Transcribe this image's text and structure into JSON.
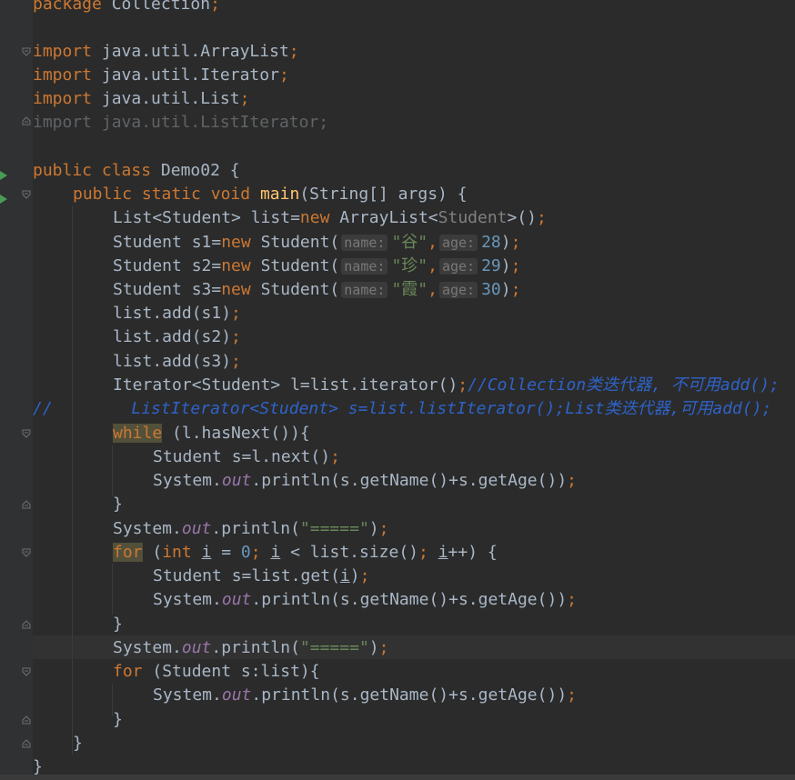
{
  "editor": {
    "lines": {
      "l1": {
        "package_kw": "package",
        "package_name": "Collection",
        "semi": ";"
      },
      "l3": {
        "kw": "import",
        "name": "java.util.ArrayList",
        "semi": ";"
      },
      "l4": {
        "kw": "import",
        "name": "java.util.Iterator",
        "semi": ";"
      },
      "l5": {
        "kw": "import",
        "name": "java.util.List",
        "semi": ";"
      },
      "l6": {
        "kw": "import",
        "name": "java.util.ListIterator",
        "semi": ";"
      },
      "l8": {
        "kw1": "public",
        "kw2": "class",
        "name": "Demo02",
        "brace": " {"
      },
      "l9": {
        "kw1": "public",
        "kw2": "static",
        "kw3": "void",
        "fn": "main",
        "rest": "(String[] args) {"
      },
      "l10": {
        "a": "List<Student> list=",
        "kw": "new",
        "b": " ArrayList<",
        "gen": "Student",
        "c": ">()",
        "semi": ";"
      },
      "l11": {
        "a": "Student s1=",
        "kw": "new",
        "b": " Student(",
        "hint1": "name:",
        "str": "\"谷\"",
        "comma": ",",
        "hint2": "age:",
        "num": "28",
        "c": ")",
        "semi": ";"
      },
      "l12": {
        "a": "Student s2=",
        "kw": "new",
        "b": " Student(",
        "hint1": "name:",
        "str": "\"珍\"",
        "comma": ",",
        "hint2": "age:",
        "num": "29",
        "c": ")",
        "semi": ";"
      },
      "l13": {
        "a": "Student s3=",
        "kw": "new",
        "b": " Student(",
        "hint1": "name:",
        "str": "\"霞\"",
        "comma": ",",
        "hint2": "age:",
        "num": "30",
        "c": ")",
        "semi": ";"
      },
      "l14": {
        "a": "list.add(s1)",
        "semi": ";"
      },
      "l15": {
        "a": "list.add(s2)",
        "semi": ";"
      },
      "l16": {
        "a": "list.add(s3)",
        "semi": ";"
      },
      "l17": {
        "a": "Iterator<Student> l=list.iterator()",
        "semi": ";",
        "cmt": "//Collection类迭代器, 不可用add();"
      },
      "l18": {
        "cmt": "//        ListIterator<Student> s=list.listIterator();List类迭代器,可用add();"
      },
      "l19": {
        "kw": "while",
        "rest": " (l.hasNext()){"
      },
      "l20": {
        "a": "Student s=l.next()",
        "semi": ";"
      },
      "l21": {
        "a": "System.",
        "field": "out",
        "b": ".println(s.getName()+s.getAge())",
        "semi": ";"
      },
      "l22": {
        "a": "}"
      },
      "l23": {
        "a": "System.",
        "field": "out",
        "b": ".println(",
        "str": "\"=====\"",
        "c": ")",
        "semi": ";"
      },
      "l24": {
        "kw": "for",
        "p1": " (",
        "kw2": "int",
        "sp": " ",
        "v1": "i",
        "eq": " = ",
        "num": "0",
        "semi1": ";",
        "sp2": " ",
        "v2": "i",
        "mid": " < list.size()",
        "semi2": ";",
        "sp3": " ",
        "v3": "i",
        "end": "++) {"
      },
      "l25": {
        "a": "Student s=list.get(",
        "v": "i",
        "b": ")",
        "semi": ";"
      },
      "l26": {
        "a": "System.",
        "field": "out",
        "b": ".println(s.getName()+s.getAge())",
        "semi": ";"
      },
      "l27": {
        "a": "}"
      },
      "l28": {
        "a": "System.",
        "field": "out",
        "b": ".println(",
        "str": "\"=====\"",
        "c": ")",
        "semi": ";"
      },
      "l29": {
        "kw": "for",
        "rest": " (Student s:list){"
      },
      "l30": {
        "a": "System.",
        "field": "out",
        "b": ".println(s.getName()+s.getAge())",
        "semi": ";"
      },
      "l31": {
        "a": "}"
      },
      "l32": {
        "a": "}"
      },
      "l33": {
        "a": "}"
      }
    }
  },
  "colors": {
    "background": "#2b2b2b",
    "keyword": "#cc7832",
    "string": "#6a8759",
    "number": "#6897bb",
    "method_decl": "#ffc66d",
    "static_field": "#9876aa",
    "comment": "#2e63c9",
    "text": "#a9b7c6"
  },
  "icons": [
    "run-class-icon",
    "run-method-icon",
    "fold-icon"
  ]
}
